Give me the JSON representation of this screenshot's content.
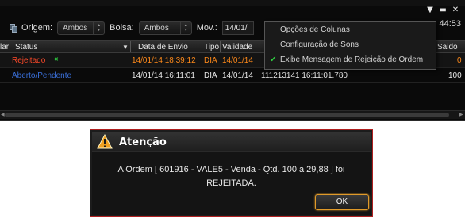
{
  "window": {
    "clock": "44:53"
  },
  "filters": {
    "origem_label": "Origem:",
    "origem_value": "Ambos",
    "bolsa_label": "Bolsa:",
    "bolsa_value": "Ambos",
    "mov_label": "Mov.:",
    "mov_value": "14/01/"
  },
  "grid": {
    "columns": [
      "lar",
      "Status",
      "Data de Envio",
      "Tipo",
      "Validade",
      "Saldo"
    ],
    "rows": [
      {
        "status": "Rejeitado",
        "data_envio": "14/01/14 18:39:12",
        "tipo": "DIA",
        "validade": "14/01/14",
        "extra": "",
        "saldo": "0"
      },
      {
        "status": "Aberto/Pendente",
        "data_envio": "14/01/14 16:11:01",
        "tipo": "DIA",
        "validade": "14/01/14",
        "extra": "111213141 16:11:01.780",
        "saldo": "100"
      }
    ]
  },
  "context_menu": {
    "items": [
      {
        "label": "Opções de Colunas",
        "checked": false
      },
      {
        "label": "Configuração de Sons",
        "checked": false
      },
      {
        "label": "Exibe Mensagem de Rejeição de Ordem",
        "checked": true
      }
    ]
  },
  "dialog": {
    "title": "Atenção",
    "message_line1": "A Ordem [ 601916 - VALE5 - Venda - Qtd. 100 a 29,88 ] foi",
    "message_line2": "REJEITADA.",
    "ok_label": "OK"
  },
  "colors": {
    "rejected": "#ff8a1a",
    "accent_green": "#2ecc40",
    "dialog_border": "#b02020",
    "ok_border": "#e09a2a"
  }
}
